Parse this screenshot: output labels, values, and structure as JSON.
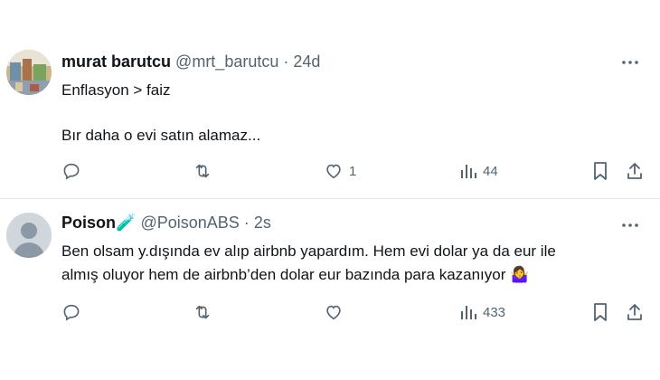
{
  "tweets": [
    {
      "display_name": "murat barutcu",
      "handle": "@mrt_barutcu",
      "separator": "·",
      "time": "24d",
      "lines": [
        "Enflasyon > faiz",
        "Bır daha o evi satın alamaz..."
      ],
      "likes": "1",
      "views": "44"
    },
    {
      "display_name": "Poison",
      "name_emoji": "🧪",
      "handle": "@PoisonABS",
      "separator": "·",
      "time": "2s",
      "lines": [
        "Ben olsam y.dışında ev alıp airbnb yapardım. Hem evi dolar ya da eur ile",
        "almış oluyor hem de airbnb’den dolar eur bazında para kazanıyor"
      ],
      "line2_emoji": "🤷‍♀️",
      "likes": "",
      "views": "433"
    }
  ],
  "icons": {
    "more": "more-horizontal-icon",
    "reply": "reply-icon",
    "retweet": "retweet-icon",
    "like": "heart-icon",
    "views": "views-chart-icon",
    "bookmark": "bookmark-icon",
    "share": "share-icon"
  },
  "colors": {
    "text_primary": "#0f1419",
    "text_secondary": "#536471",
    "divider": "#e6e9ec",
    "avatar_default": "#cfd6dc"
  }
}
